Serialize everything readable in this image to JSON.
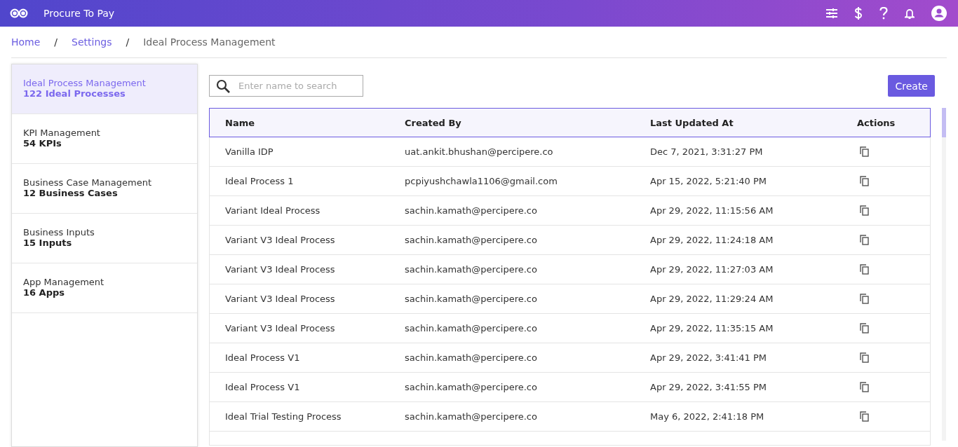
{
  "app": {
    "title": "Procure To Pay"
  },
  "breadcrumb": [
    {
      "label": "Home",
      "link": true
    },
    {
      "label": "Settings",
      "link": true
    },
    {
      "label": "Ideal Process Management",
      "link": false
    }
  ],
  "breadcrumb_separators": [
    "/",
    "/"
  ],
  "sidebar": {
    "items": [
      {
        "title": "Ideal Process Management",
        "count": "122 Ideal Processes",
        "selected": true
      },
      {
        "title": "KPI Management",
        "count": "54 KPIs",
        "selected": false
      },
      {
        "title": "Business Case Management",
        "count": "12 Business Cases",
        "selected": false
      },
      {
        "title": "Business Inputs",
        "count": "15 Inputs",
        "selected": false
      },
      {
        "title": "App Management",
        "count": "16 Apps",
        "selected": false
      }
    ]
  },
  "search": {
    "placeholder": "Enter name to search"
  },
  "create_button": "Create",
  "table": {
    "columns": [
      "Name",
      "Created By",
      "Last Updated At",
      "Actions"
    ],
    "rows": [
      {
        "name": "Vanilla IDP",
        "created_by": "uat.ankit.bhushan@percipere.co",
        "updated": "Dec 7, 2021, 3:31:27 PM"
      },
      {
        "name": "Ideal Process 1",
        "created_by": "pcpiyushchawla1106@gmail.com",
        "updated": "Apr 15, 2022, 5:21:40 PM"
      },
      {
        "name": "Variant Ideal Process",
        "created_by": "sachin.kamath@percipere.co",
        "updated": "Apr 29, 2022, 11:15:56 AM"
      },
      {
        "name": "Variant V3 Ideal Process",
        "created_by": "sachin.kamath@percipere.co",
        "updated": "Apr 29, 2022, 11:24:18 AM"
      },
      {
        "name": "Variant V3 Ideal Process",
        "created_by": "sachin.kamath@percipere.co",
        "updated": "Apr 29, 2022, 11:27:03 AM"
      },
      {
        "name": "Variant V3 Ideal Process",
        "created_by": "sachin.kamath@percipere.co",
        "updated": "Apr 29, 2022, 11:29:24 AM"
      },
      {
        "name": "Variant V3 Ideal Process",
        "created_by": "sachin.kamath@percipere.co",
        "updated": "Apr 29, 2022, 11:35:15 AM"
      },
      {
        "name": "Ideal Process V1",
        "created_by": "sachin.kamath@percipere.co",
        "updated": "Apr 29, 2022, 3:41:41 PM"
      },
      {
        "name": "Ideal Process V1",
        "created_by": "sachin.kamath@percipere.co",
        "updated": "Apr 29, 2022, 3:41:55 PM"
      },
      {
        "name": "Ideal Trial Testing Process",
        "created_by": "sachin.kamath@percipere.co",
        "updated": "May 6, 2022, 2:41:18 PM"
      }
    ]
  }
}
